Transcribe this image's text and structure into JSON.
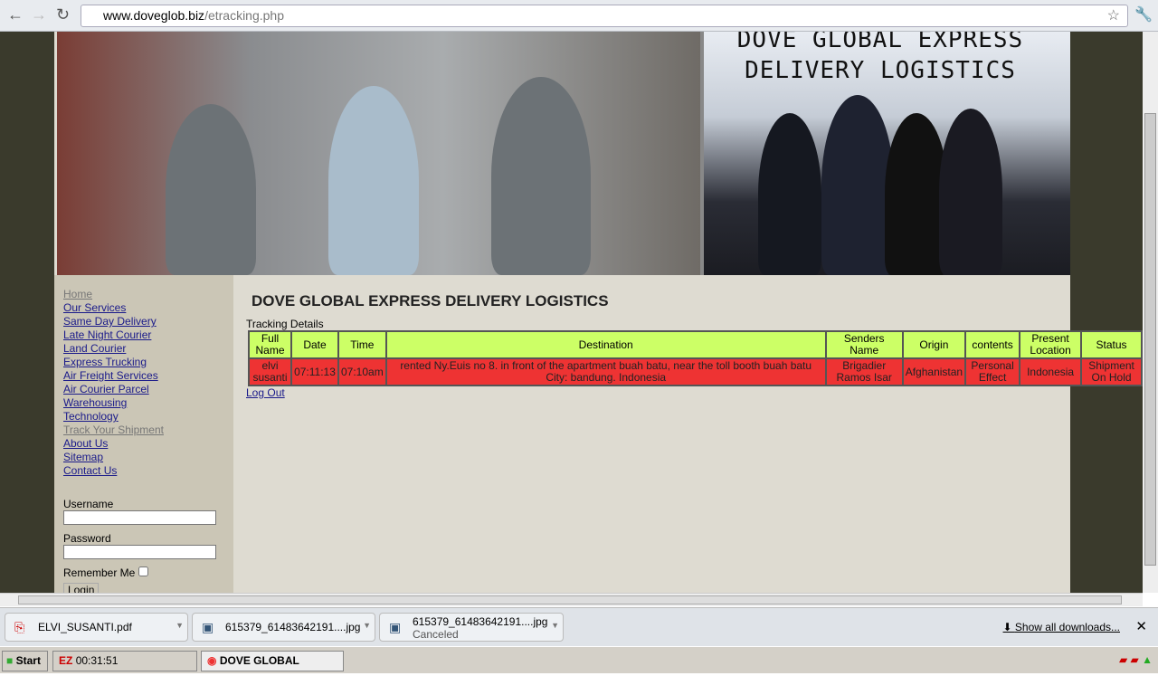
{
  "browser": {
    "url_host": "www.doveglob.biz",
    "url_path": "/etracking.php"
  },
  "site": {
    "banner_title_1": "DOVE GLOBAL EXPRESS",
    "banner_title_2": "DELIVERY LOGISTICS",
    "nav": [
      "Home",
      "Our Services",
      "Same Day Delivery",
      "Late Night Courier",
      "Land Courier",
      "Express Trucking",
      "Air Freight Services",
      "Air Courier Parcel",
      "Warehousing",
      "Technology",
      "Track Your Shipment",
      "About Us",
      "Sitemap",
      "Contact Us"
    ],
    "login": {
      "username_label": "Username",
      "password_label": "Password",
      "remember_label": "Remember Me",
      "login_button": "Login"
    },
    "heading": "DOVE GLOBAL EXPRESS DELIVERY LOGISTICS",
    "tracking_label": "Tracking Details",
    "table": {
      "headers": [
        "Full Name",
        "Date",
        "Time",
        "Destination",
        "Senders Name",
        "Origin",
        "contents",
        "Present Location",
        "Status"
      ],
      "rows": [
        [
          "elvi susanti",
          "07:11:13",
          "07:10am",
          "rented Ny.Euis no 8. in front of the apartment buah batu, near the toll booth buah batu City: bandung. Indonesia",
          "Brigadier Ramos Isar",
          "Afghanistan",
          "Personal Effect",
          "Indonesia",
          "Shipment On Hold"
        ]
      ]
    },
    "logout": "Log Out"
  },
  "downloads": {
    "items": [
      {
        "name": "ELVI_SUSANTI.pdf",
        "status": ""
      },
      {
        "name": "615379_61483642191....jpg",
        "status": ""
      },
      {
        "name": "615379_61483642191....jpg",
        "status": "Canceled"
      }
    ],
    "show_all": "Show all downloads..."
  },
  "taskbar": {
    "start": "Start",
    "task1": "00:31:51",
    "task2": "DOVE GLOBAL EXPRES..."
  },
  "colors": {
    "header_row": "#ccff66",
    "data_row": "#ee3333"
  }
}
